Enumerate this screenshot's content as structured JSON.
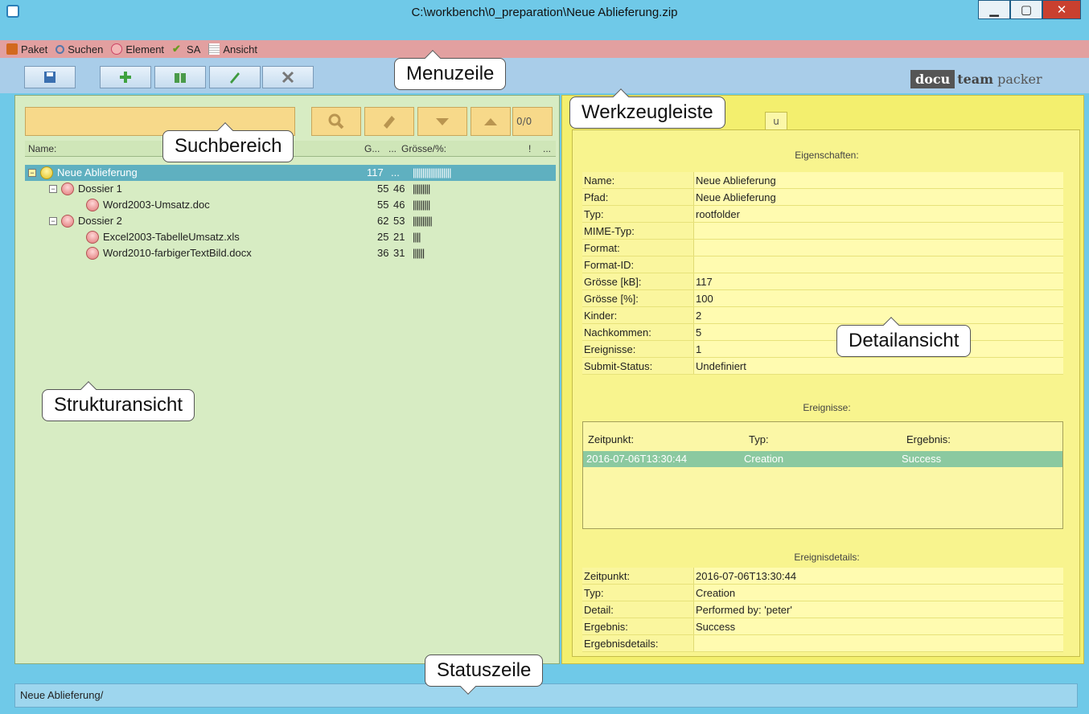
{
  "window": {
    "title": "C:\\workbench\\0_preparation\\Neue Ablieferung.zip"
  },
  "menu": {
    "items": [
      "Paket",
      "Suchen",
      "Element",
      "SA",
      "Ansicht"
    ]
  },
  "brand": {
    "part1": "docu",
    "part2": "team",
    "part3": "packer"
  },
  "search": {
    "counter": "0/0"
  },
  "tree": {
    "headers": {
      "name": "Name:",
      "g": "G...",
      "dots": "...",
      "groesse": "Grösse/%:",
      "bang": "!",
      "more": "..."
    },
    "rows": [
      {
        "name": "Neue Ablieferung",
        "g": "117",
        "p": "...",
        "bar": "||||||||||||||||||||"
      },
      {
        "name": "Dossier 1",
        "g": "55",
        "p": "46",
        "bar": "|||||||||"
      },
      {
        "name": "Word2003-Umsatz.doc",
        "g": "55",
        "p": "46",
        "bar": "|||||||||"
      },
      {
        "name": "Dossier 2",
        "g": "62",
        "p": "53",
        "bar": "||||||||||"
      },
      {
        "name": "Excel2003-TabelleUmsatz.xls",
        "g": "25",
        "p": "21",
        "bar": "||||"
      },
      {
        "name": "Word2010-farbigerTextBild.docx",
        "g": "36",
        "p": "31",
        "bar": "||||||"
      }
    ]
  },
  "detail": {
    "tab_stub": "u",
    "props_title": "Eigenschaften:",
    "props": [
      {
        "k": "Name:",
        "v": "Neue Ablieferung"
      },
      {
        "k": "Pfad:",
        "v": "Neue Ablieferung"
      },
      {
        "k": "Typ:",
        "v": "rootfolder"
      },
      {
        "k": "MIME-Typ:",
        "v": ""
      },
      {
        "k": "Format:",
        "v": ""
      },
      {
        "k": "Format-ID:",
        "v": ""
      },
      {
        "k": "Grösse [kB]:",
        "v": "117"
      },
      {
        "k": "Grösse [%]:",
        "v": "100"
      },
      {
        "k": "Kinder:",
        "v": "2"
      },
      {
        "k": "Nachkommen:",
        "v": "5"
      },
      {
        "k": "Ereignisse:",
        "v": "1"
      },
      {
        "k": "Submit-Status:",
        "v": "Undefiniert"
      }
    ],
    "events_title": "Ereignisse:",
    "events_headers": {
      "time": "Zeitpunkt:",
      "type": "Typ:",
      "result": "Ergebnis:"
    },
    "event": {
      "time": "2016-07-06T13:30:44",
      "type": "Creation",
      "result": "Success"
    },
    "eventdetails_title": "Ereignisdetails:",
    "eventdetails": [
      {
        "k": "Zeitpunkt:",
        "v": "2016-07-06T13:30:44"
      },
      {
        "k": "Typ:",
        "v": "Creation"
      },
      {
        "k": "Detail:",
        "v": "Performed by: 'peter'"
      },
      {
        "k": "Ergebnis:",
        "v": "Success"
      },
      {
        "k": "Ergebnisdetails:",
        "v": ""
      }
    ]
  },
  "status": {
    "text": "Neue Ablieferung/"
  },
  "callouts": {
    "menuzeile": "Menuzeile",
    "werkzeugleiste": "Werkzeugleiste",
    "suchbereich": "Suchbereich",
    "strukturansicht": "Strukturansicht",
    "detailansicht": "Detailansicht",
    "statuszeile": "Statuszeile"
  },
  "colors": {
    "title_bar": "#6fc9e8",
    "menubar": "#e2a0a0",
    "toolbar": "#a9cde9",
    "tree_bg": "#d7ecc3",
    "detail_bg": "#f3ef6e",
    "selection": "#5fb0c0"
  }
}
